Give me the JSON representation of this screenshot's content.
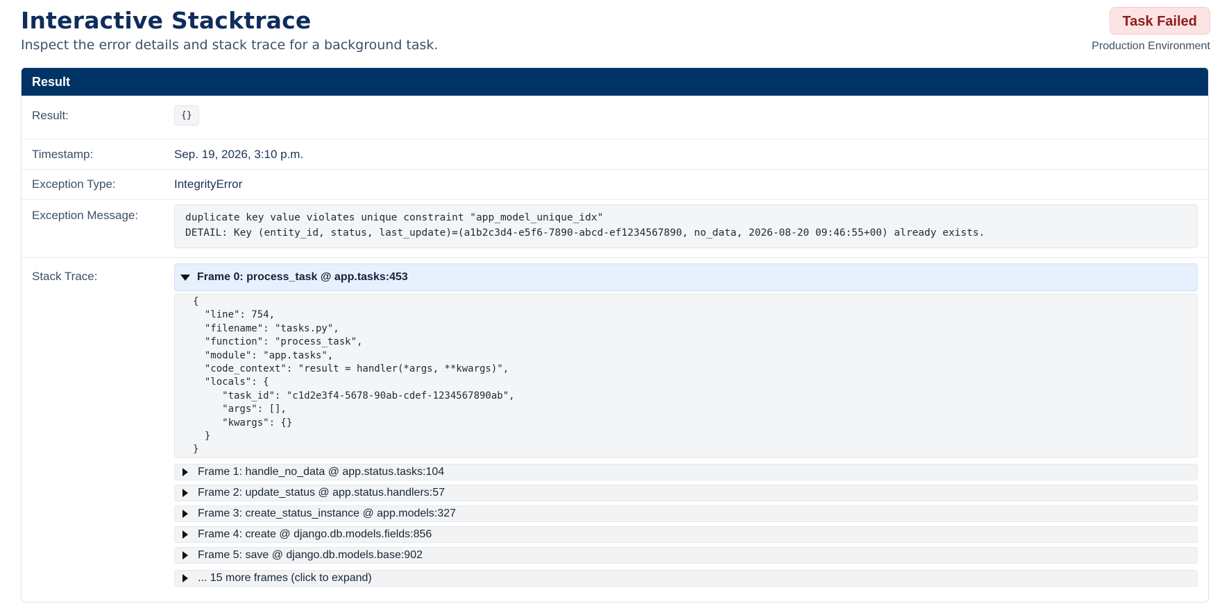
{
  "header": {
    "title": "Interactive Stacktrace",
    "subtitle": "Inspect the error details and stack trace for a background task.",
    "status_badge": "Task Failed",
    "environment": "Production Environment"
  },
  "panel": {
    "title": "Result",
    "rows": {
      "result": {
        "label": "Result:",
        "value": "{}"
      },
      "timestamp": {
        "label": "Timestamp:",
        "value": "Sep. 19, 2026, 3:10 p.m."
      },
      "exception_type": {
        "label": "Exception Type:",
        "value": "IntegrityError"
      },
      "exception_message": {
        "label": "Exception Message:",
        "value": "duplicate key value violates unique constraint \"app_model_unique_idx\"\nDETAIL: Key (entity_id, status, last_update)=(a1b2c3d4-e5f6-7890-abcd-ef1234567890, no_data, 2026-08-20 09:46:55+00) already exists."
      },
      "stack_trace": {
        "label": "Stack Trace:"
      }
    }
  },
  "stack": {
    "expanded_frame": {
      "label": "Frame 0: process_task @ app.tasks:453",
      "body": "{\n  \"line\": 754,\n  \"filename\": \"tasks.py\",\n  \"function\": \"process_task\",\n  \"module\": \"app.tasks\",\n  \"code_context\": \"result = handler(*args, **kwargs)\",\n  \"locals\": {\n     \"task_id\": \"c1d2e3f4-5678-90ab-cdef-1234567890ab\",\n     \"args\": [],\n     \"kwargs\": {}\n  }\n}"
    },
    "frames": [
      "Frame 1: handle_no_data @ app.status.tasks:104",
      "Frame 2: update_status @ app.status.handlers:57",
      "Frame 3: create_status_instance @ app.models:327",
      "Frame 4: create @ django.db.models.fields:856",
      "Frame 5: save @ django.db.models.base:902"
    ],
    "more_frames": "... 15 more frames (click to expand)"
  },
  "icons": {
    "expanded": "triangle-down-icon",
    "collapsed": "triangle-right-icon"
  },
  "colors": {
    "panel_header": "#003366",
    "title": "#0f2d5c",
    "badge_bg": "#fde4e4",
    "badge_text": "#8a1d1d",
    "expanded_frame_bg": "#e7f0fd"
  }
}
